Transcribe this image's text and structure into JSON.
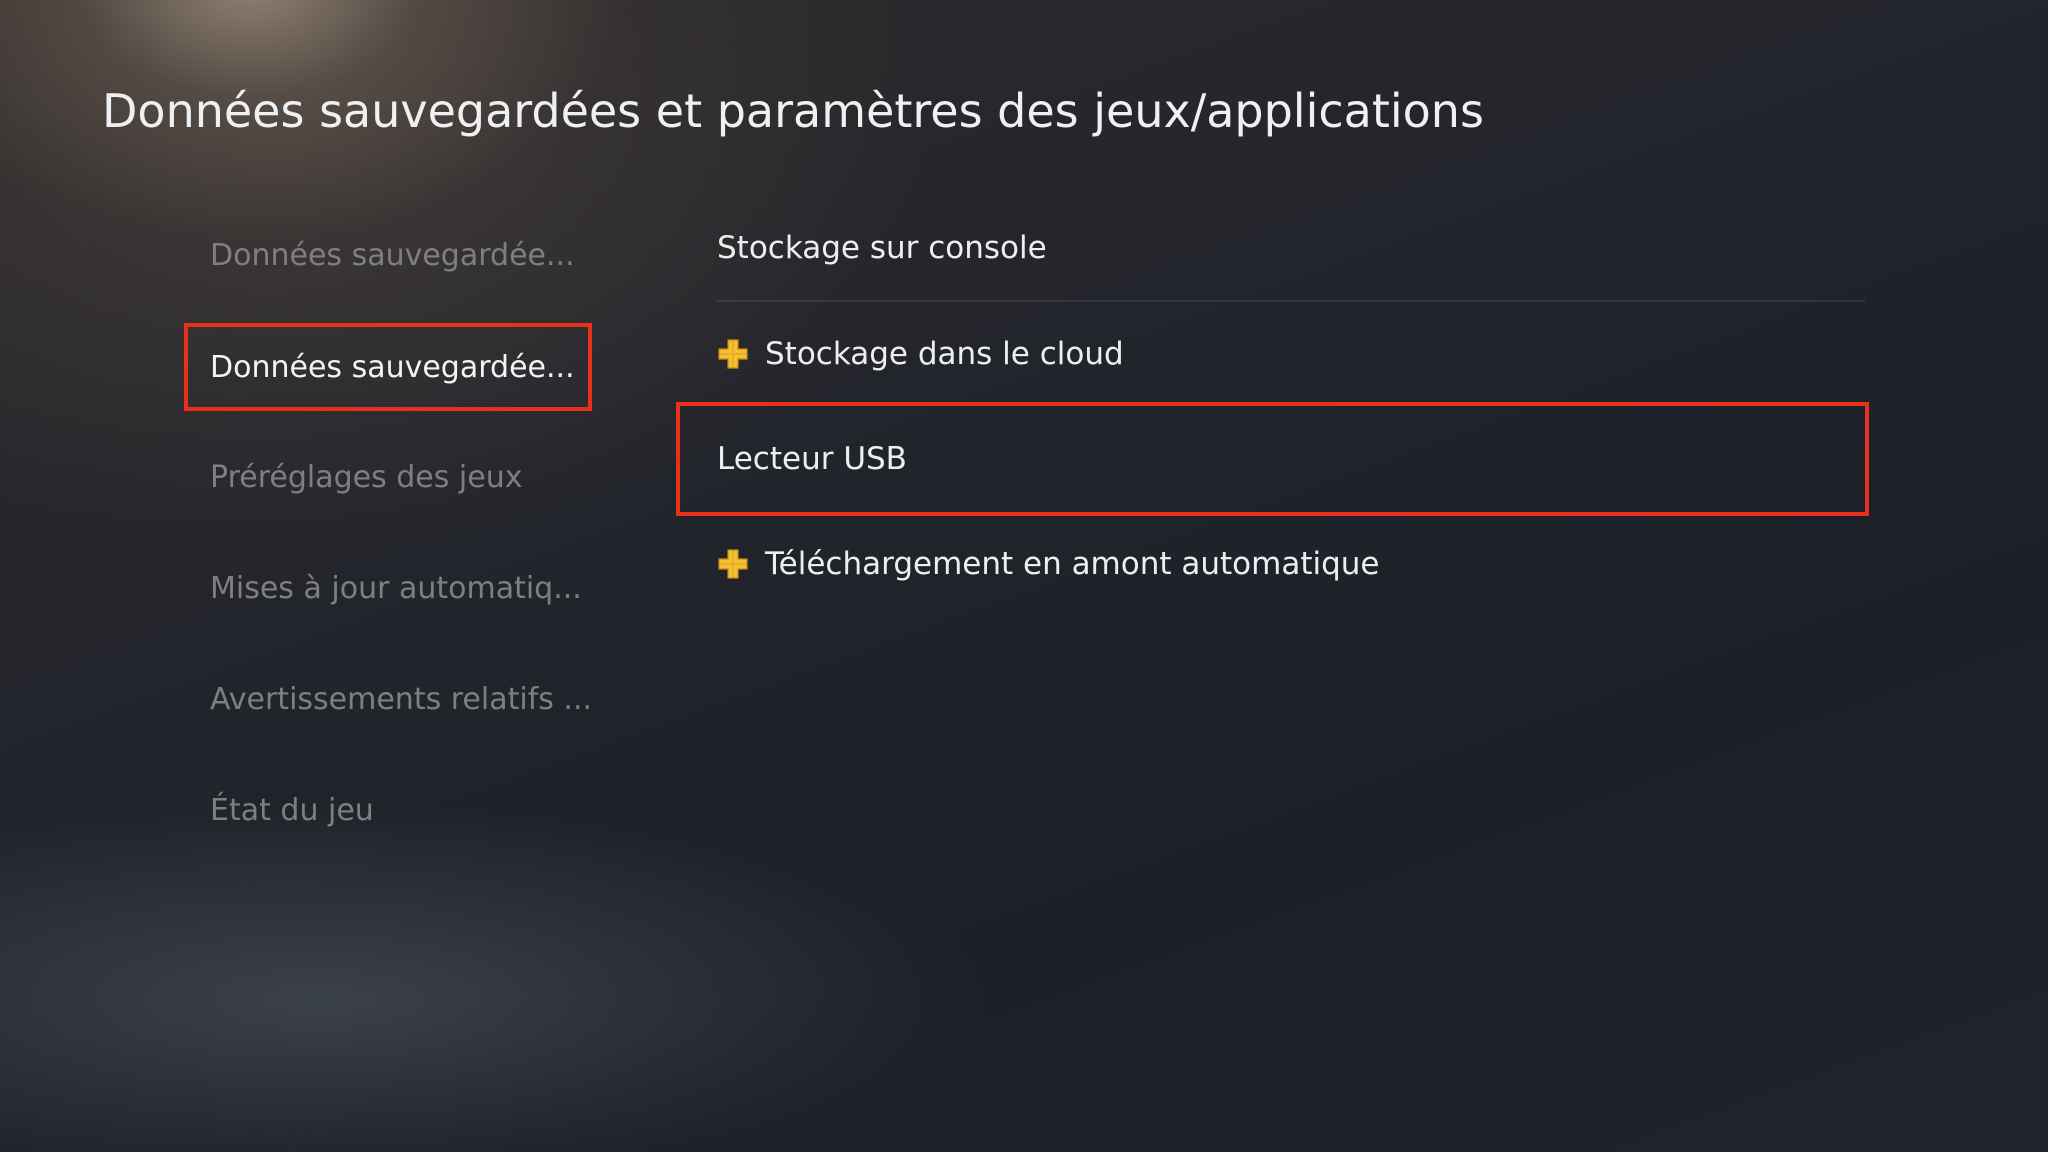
{
  "header": {
    "title": "Données sauvegardées et paramètres des jeux/applications"
  },
  "sidebar": {
    "items": [
      {
        "label": "Données sauvegardée...",
        "selected": false
      },
      {
        "label": "Données sauvegardée...",
        "selected": true
      },
      {
        "label": "Préréglages des jeux",
        "selected": false
      },
      {
        "label": "Mises à jour automatiq...",
        "selected": false
      },
      {
        "label": "Avertissements relatifs ...",
        "selected": false
      },
      {
        "label": "État du jeu",
        "selected": false
      }
    ]
  },
  "main": {
    "options": [
      {
        "label": "Stockage sur console",
        "icon": null,
        "selected": false
      },
      {
        "label": "Stockage dans le cloud",
        "icon": "ps-plus-icon",
        "selected": false
      },
      {
        "label": "Lecteur USB",
        "icon": null,
        "selected": true
      },
      {
        "label": "Téléchargement en amont automatique",
        "icon": "ps-plus-icon",
        "selected": false
      }
    ]
  },
  "colors": {
    "highlight": "#e8301c",
    "ps_plus_gold": "#f3c132",
    "text_active": "#eceef0",
    "text_inactive": "#7d7f83"
  }
}
